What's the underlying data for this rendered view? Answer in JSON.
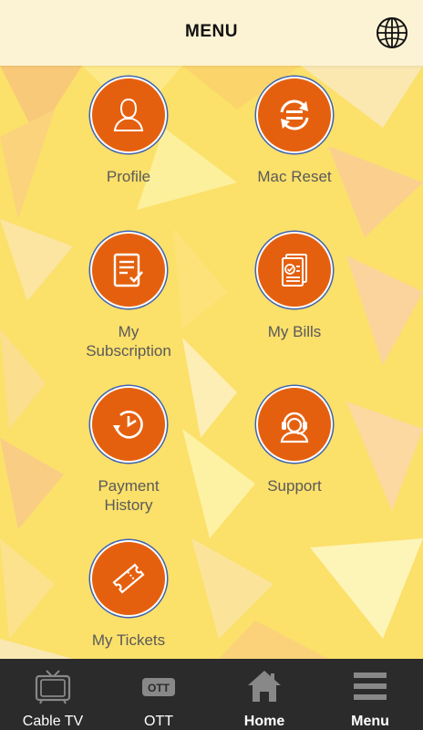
{
  "header": {
    "title": "MENU",
    "language_icon": "globe-icon"
  },
  "menu": {
    "items": [
      {
        "label": "Profile",
        "icon": "user-icon"
      },
      {
        "label": "Mac Reset",
        "icon": "refresh-icon"
      },
      {
        "label": "My\nSubscription",
        "icon": "subscription-doc-icon"
      },
      {
        "label": "My Bills",
        "icon": "bills-icon"
      },
      {
        "label": "Payment\nHistory",
        "icon": "history-clock-icon"
      },
      {
        "label": "Support",
        "icon": "support-agent-icon"
      },
      {
        "label": "My Tickets",
        "icon": "ticket-icon"
      }
    ]
  },
  "nav": {
    "items": [
      {
        "label": "Cable TV",
        "icon": "tv-icon"
      },
      {
        "label": "OTT",
        "icon": "ott-icon",
        "badge": "OTT"
      },
      {
        "label": "Home",
        "icon": "home-icon"
      },
      {
        "label": "Menu",
        "icon": "hamburger-menu-icon"
      }
    ]
  },
  "colors": {
    "accent": "#e5600e",
    "ring": "#3d62b0",
    "header_bg": "#fcf3d4",
    "nav_bg": "#2b2b2b"
  }
}
